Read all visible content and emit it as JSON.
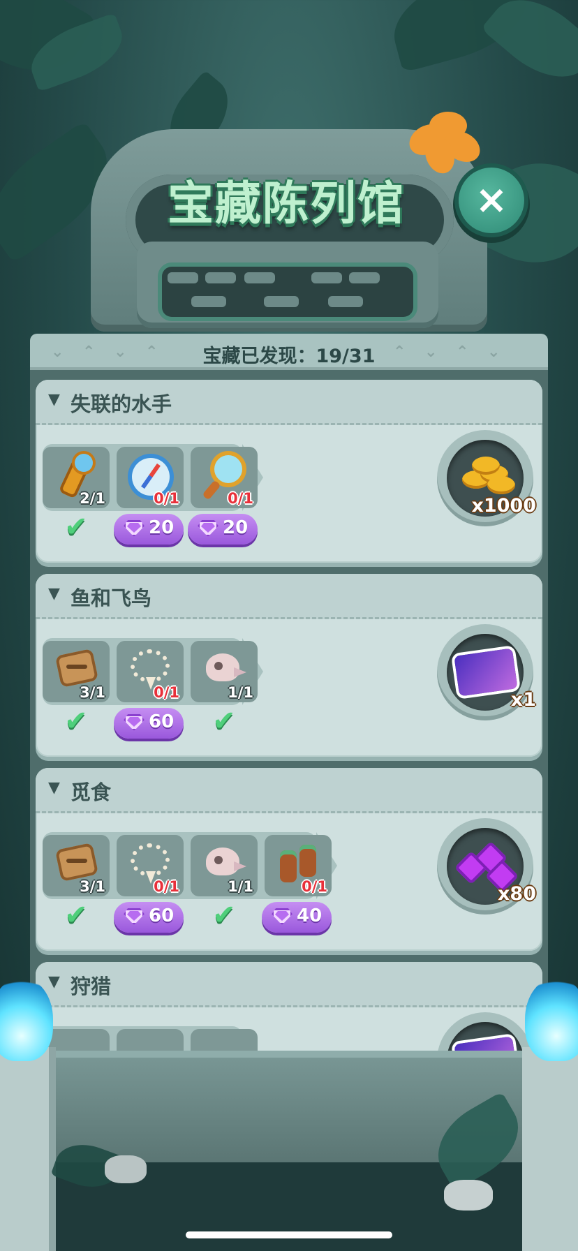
{
  "title": "宝藏陈列馆",
  "close_icon": "×",
  "discovered_text": "宝藏已发现：19/31",
  "colors": {
    "accent_green": "#4fcf7b",
    "gem_purple": "#9a58dc",
    "missing_red": "#e8303a"
  },
  "sections": [
    {
      "title": "失联的水手",
      "items": [
        {
          "icon": "spyglass-icon",
          "count": "2/1",
          "status": "check"
        },
        {
          "icon": "compass-icon",
          "count": "0/1",
          "status": "gem",
          "price": "20"
        },
        {
          "icon": "magnifier-icon",
          "count": "0/1",
          "status": "gem",
          "price": "20"
        }
      ],
      "reward": {
        "icon": "gold-coins-icon",
        "label": "x1000"
      }
    },
    {
      "title": "鱼和飞鸟",
      "items": [
        {
          "icon": "fish-fossil-icon",
          "count": "3/1",
          "status": "check"
        },
        {
          "icon": "bone-necklace-icon",
          "count": "0/1",
          "status": "gem",
          "price": "60"
        },
        {
          "icon": "bird-skull-icon",
          "count": "1/1",
          "status": "check"
        }
      ],
      "reward": {
        "icon": "magic-ticket-icon",
        "label": "x1"
      }
    },
    {
      "title": "觅食",
      "items": [
        {
          "icon": "fish-fossil-icon",
          "count": "3/1",
          "status": "check"
        },
        {
          "icon": "bone-necklace-icon",
          "count": "0/1",
          "status": "gem",
          "price": "60"
        },
        {
          "icon": "bird-skull-icon",
          "count": "1/1",
          "status": "check"
        },
        {
          "icon": "binoculars-icon",
          "count": "0/1",
          "status": "gem",
          "price": "40"
        }
      ],
      "reward": {
        "icon": "purple-gems-icon",
        "label": "x80"
      }
    },
    {
      "title": "狩猎",
      "items": [],
      "reward": {
        "icon": "magic-ticket-icon",
        "label": ""
      }
    }
  ]
}
